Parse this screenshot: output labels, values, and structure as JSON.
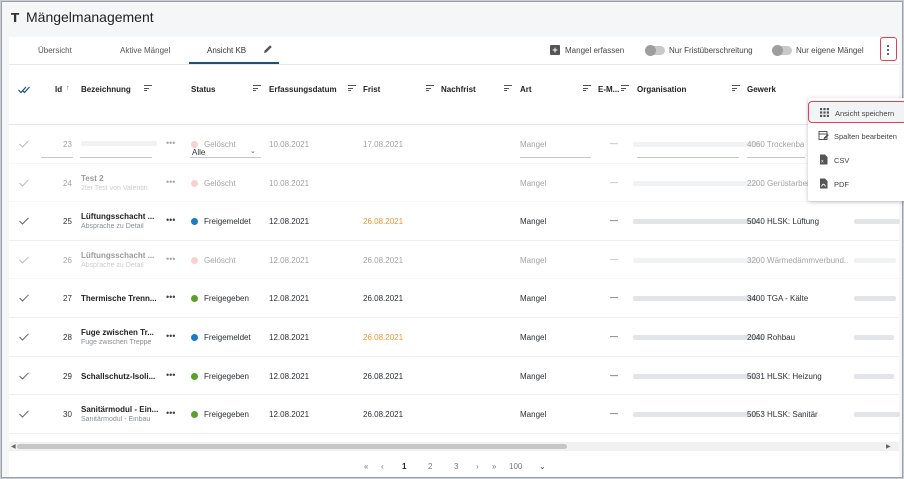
{
  "app": {
    "title": "Mängelmanagement",
    "title_icon": "tool-icon"
  },
  "tabs": [
    "Übersicht",
    "Aktive Mängel",
    "Ansicht KB"
  ],
  "toolbar": {
    "add_label": "Mangel erfassen",
    "toggle1_label": "Nur Fristüberschreitung",
    "toggle2_label": "Nur eigene Mängel"
  },
  "columns": {
    "id": "Id",
    "bezeichnung": "Bezeichnung",
    "status": "Status",
    "erfassung": "Erfassungsdatum",
    "frist": "Frist",
    "nachfrist": "Nachfrist",
    "art": "Art",
    "email": "E-M...",
    "organisation": "Organisation",
    "gewerk": "Gewerk"
  },
  "status_filter": "Alle",
  "status_colors": {
    "Gelöscht": "#ef9a9a",
    "Freigemeldet": "#1f7bc1",
    "Freigegeben": "#5aa02c"
  },
  "overdue_color": "#f0952a",
  "rows": [
    {
      "id": "23",
      "title": "",
      "sub": "",
      "status": "Gelöscht",
      "erfassung": "10.08.2021",
      "frist": "17.08.2021",
      "nachfrist": "",
      "art": "Mangel",
      "email": "—",
      "gewerk": "4060 Trockenba",
      "deleted": true
    },
    {
      "id": "24",
      "title": "Test 2",
      "sub": "2ter Test von Valentin",
      "status": "Gelöscht",
      "erfassung": "10.08.2021",
      "frist": "",
      "nachfrist": "",
      "art": "Mangel",
      "email": "—",
      "gewerk": "2200 Gerüstarbeiten",
      "deleted": true
    },
    {
      "id": "25",
      "title": "Lüftungsschacht ...",
      "sub": "Absprache zu Detail",
      "status": "Freigemeldet",
      "erfassung": "12.08.2021",
      "frist": "26.08.2021",
      "nachfrist": "",
      "art": "Mangel",
      "email": "—",
      "gewerk": "5040 HLSK: Lüftung",
      "deleted": false,
      "overdue": true
    },
    {
      "id": "26",
      "title": "Lüftungsschacht ...",
      "sub": "Absprache zu Detail",
      "status": "Gelöscht",
      "erfassung": "12.08.2021",
      "frist": "26.08.2021",
      "nachfrist": "",
      "art": "Mangel",
      "email": "—",
      "gewerk": "3200 Wärmedämmverbund...",
      "deleted": true
    },
    {
      "id": "27",
      "title": "Thermische Trenn...",
      "sub": "",
      "status": "Freigegeben",
      "erfassung": "12.08.2021",
      "frist": "26.08.2021",
      "nachfrist": "",
      "art": "Mangel",
      "email": "—",
      "gewerk": "3400 TGA - Kälte",
      "deleted": false
    },
    {
      "id": "28",
      "title": "Fuge zwischen Tr...",
      "sub": "Fuge zwischen Treppe",
      "status": "Freigemeldet",
      "erfassung": "12.08.2021",
      "frist": "26.08.2021",
      "nachfrist": "",
      "art": "Mangel",
      "email": "—",
      "gewerk": "2040 Rohbau",
      "deleted": false,
      "overdue": true
    },
    {
      "id": "29",
      "title": "Schallschutz-Isoli...",
      "sub": "",
      "status": "Freigegeben",
      "erfassung": "12.08.2021",
      "frist": "26.08.2021",
      "nachfrist": "",
      "art": "Mangel",
      "email": "—",
      "gewerk": "5031 HLSK: Heizung",
      "deleted": false
    },
    {
      "id": "30",
      "title": "Sanitärmodul - Ein...",
      "sub": "Sanitärmodul - Einbau",
      "status": "Freigegeben",
      "erfassung": "12.08.2021",
      "frist": "26.08.2021",
      "nachfrist": "",
      "art": "Mangel",
      "email": "—",
      "gewerk": "5053 HLSK: Sanitär",
      "deleted": false
    }
  ],
  "pagination": {
    "first": "«",
    "prev": "‹",
    "pages": [
      "1",
      "2",
      "3"
    ],
    "current": "1",
    "next": "›",
    "last": "»",
    "page_size": "100"
  },
  "menu": [
    {
      "label": "Ansicht speichern",
      "icon": "grid-icon"
    },
    {
      "label": "Spalten bearbeiten",
      "icon": "edit-columns-icon"
    },
    {
      "label": "CSV",
      "icon": "csv-file-icon"
    },
    {
      "label": "PDF",
      "icon": "pdf-file-icon"
    }
  ]
}
